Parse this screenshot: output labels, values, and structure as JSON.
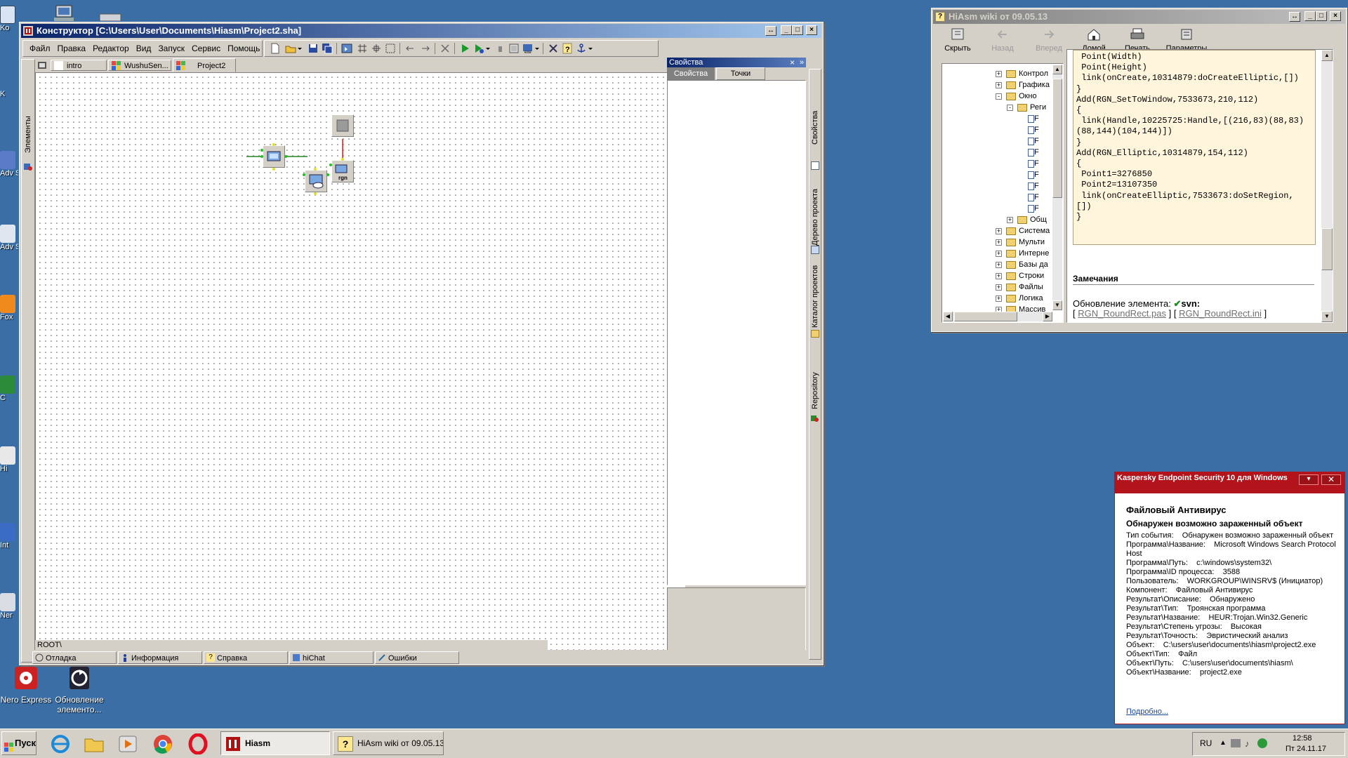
{
  "desktop": {
    "icons": [
      {
        "label": "Nero Express"
      },
      {
        "label": "Обновление элементо..."
      }
    ],
    "edge_labels": [
      "Ko",
      "K",
      "Adv S",
      "Adv S",
      "Fox",
      "C",
      "Hi",
      "Int",
      "Ner"
    ]
  },
  "konstruktor": {
    "title": "Конструктор [C:\\Users\\User\\Documents\\Hiasm\\Project2.sha]",
    "menu": [
      "Файл",
      "Правка",
      "Редактор",
      "Вид",
      "Запуск",
      "Сервис",
      "Помощь"
    ],
    "doc_tabs": [
      "intro",
      "WushuSen...",
      "Project2"
    ],
    "left_tab": "Элементы",
    "right_vtabs": [
      "Свойства",
      "Дерево проекта",
      "Каталог проектов",
      "Repository"
    ],
    "props_panel": {
      "title": "Свойства",
      "tabs": [
        "Свойства",
        "Точки"
      ]
    },
    "status_path": "ROOT\\",
    "bottom_tabs": [
      "Отладка",
      "Информация",
      "Справка",
      "hiChat",
      "Ошибки"
    ],
    "rgn_label": "rgn"
  },
  "wiki": {
    "title": "HiAsm wiki от 09.05.13",
    "toolbar": [
      "Скрыть",
      "Назад",
      "Вперед",
      "Домой",
      "Печать",
      "Параметры"
    ],
    "tree": [
      {
        "label": "Контрол",
        "sign": "+"
      },
      {
        "label": "Графика",
        "sign": "+"
      },
      {
        "label": "Окно",
        "sign": "-"
      },
      {
        "label": "Реги",
        "sign": "-"
      },
      {
        "label": "F",
        "sign": ""
      },
      {
        "label": "F",
        "sign": ""
      },
      {
        "label": "F",
        "sign": ""
      },
      {
        "label": "F",
        "sign": ""
      },
      {
        "label": "F",
        "sign": ""
      },
      {
        "label": "F",
        "sign": ""
      },
      {
        "label": "F",
        "sign": ""
      },
      {
        "label": "F",
        "sign": ""
      },
      {
        "label": "F",
        "sign": ""
      },
      {
        "label": "Общ",
        "sign": "+"
      },
      {
        "label": "Система",
        "sign": "+"
      },
      {
        "label": "Мульти",
        "sign": "+"
      },
      {
        "label": "Интерне",
        "sign": "+"
      },
      {
        "label": "Базы да",
        "sign": "+"
      },
      {
        "label": "Строки",
        "sign": "+"
      },
      {
        "label": "Файлы",
        "sign": "+"
      },
      {
        "label": "Логика",
        "sign": "+"
      },
      {
        "label": "Массив",
        "sign": "+"
      }
    ],
    "code": " Point(Width)\n Point(Height)\n link(onCreate,10314879:doCreateElliptic,[])\n}\nAdd(RGN_SetToWindow,7533673,210,112)\n{\n link(Handle,10225725:Handle,[(216,83)(88,83)\n(88,144)(104,144)])\n}\nAdd(RGN_Elliptic,10314879,154,112)\n{\n Point1=3276850\n Point2=13107350\n link(onCreateElliptic,7533673:doSetRegion,\n[])\n}",
    "remarks_title": "Замечания",
    "update_label": "Обновление элемента:",
    "svn_label": "svn:",
    "link1": "RGN_RoundRect.pas",
    "link2": "RGN_RoundRect.ini",
    "bracket_open": "[",
    "bracket_mid": "] [",
    "bracket_close": "]"
  },
  "kaspersky": {
    "title": "Kaspersky Endpoint Security 10 для Windows",
    "heading": "Файловый Антивирус",
    "subheading": "Обнаружен возможно зараженный объект",
    "details": [
      "Тип события:    Обнаружен возможно зараженный объект",
      "Программа\\Название:    Microsoft Windows Search Protocol Host",
      "Программа\\Путь:    c:\\windows\\system32\\",
      "Программа\\ID процесса:    3588",
      "Пользователь:    WORKGROUP\\WINSRV$ (Инициатор)",
      "Компонент:    Файловый Антивирус",
      "Результат\\Описание:    Обнаружено",
      "Результат\\Тип:    Троянская программа",
      "Результат\\Название:    HEUR:Trojan.Win32.Generic",
      "Результат\\Степень угрозы:    Высокая",
      "Результат\\Точность:    Эвристический анализ",
      "Объект:    C:\\users\\user\\documents\\hiasm\\project2.exe",
      "Объект\\Тип:    Файл",
      "Объект\\Путь:    C:\\users\\user\\documents\\hiasm\\",
      "Объект\\Название:    project2.exe"
    ],
    "more_link": "Подробно..."
  },
  "taskbar": {
    "start": "Пуск",
    "tasks": [
      "Hiasm",
      "HiAsm wiki от 09.05.13"
    ],
    "lang": "RU",
    "time": "12:58",
    "date": "Пт 24.11.17"
  },
  "colors": {
    "desktop": "#3a6ea5",
    "title_active": "#0a246a",
    "kaspersky_title": "#b3141b",
    "code_bg": "#fff4dc",
    "link": "#1a4aa0"
  }
}
